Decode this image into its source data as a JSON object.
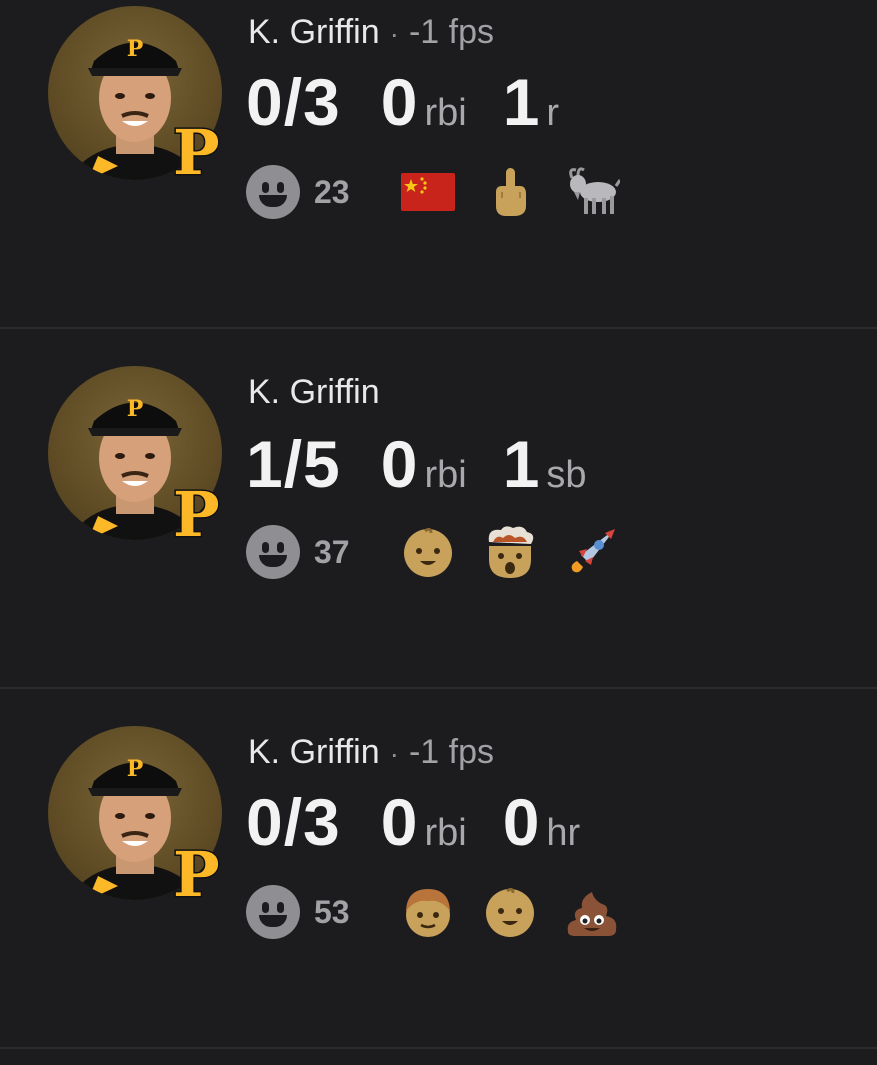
{
  "feed": {
    "posts": [
      {
        "player_name": "K. Griffin",
        "separator": "·",
        "fps": "-1 fps",
        "stats": [
          {
            "value": "0/3",
            "unit": ""
          },
          {
            "value": "0",
            "unit": "rbi"
          },
          {
            "value": "1",
            "unit": "r"
          }
        ],
        "reaction_count": "23",
        "reaction_emojis": [
          "china-flag-icon",
          "middle-finger-icon",
          "goat-icon"
        ]
      },
      {
        "player_name": "K. Griffin",
        "separator": "",
        "fps": "",
        "stats": [
          {
            "value": "1/5",
            "unit": ""
          },
          {
            "value": "0",
            "unit": "rbi"
          },
          {
            "value": "1",
            "unit": "sb"
          }
        ],
        "reaction_count": "37",
        "reaction_emojis": [
          "baby-icon",
          "exploding-head-icon",
          "rocket-icon"
        ]
      },
      {
        "player_name": "K. Griffin",
        "separator": "·",
        "fps": "-1 fps",
        "stats": [
          {
            "value": "0/3",
            "unit": ""
          },
          {
            "value": "0",
            "unit": "rbi"
          },
          {
            "value": "0",
            "unit": "hr"
          }
        ],
        "reaction_count": "53",
        "reaction_emojis": [
          "boy-icon",
          "baby-icon",
          "pile-of-poo-icon"
        ]
      }
    ]
  },
  "team_logo": {
    "letter": "P",
    "color": "#fdb827"
  },
  "colors": {
    "background": "#1c1c1e",
    "divider": "#2c2c2e",
    "primary_text": "#f2f2f2",
    "secondary_text": "#a1a1a6"
  }
}
